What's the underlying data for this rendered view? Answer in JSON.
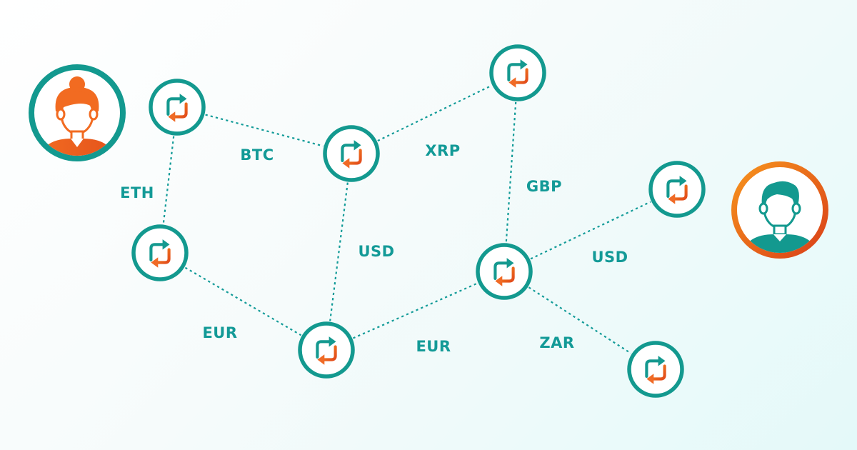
{
  "colors": {
    "teal": "#13998f",
    "label_teal": "#139a97",
    "orange": "#f37021",
    "orange_dark": "#e0471a",
    "skin": "#ffffff"
  },
  "icons": {
    "node": "exchange-arrows-icon",
    "sender": "woman-avatar-icon",
    "receiver": "man-avatar-icon"
  },
  "nodes": [
    {
      "id": "n1"
    },
    {
      "id": "n2"
    },
    {
      "id": "n3"
    },
    {
      "id": "n4"
    },
    {
      "id": "n5"
    },
    {
      "id": "n6"
    },
    {
      "id": "n7"
    },
    {
      "id": "n8"
    },
    {
      "id": "n9"
    }
  ],
  "edges": [
    {
      "from": "n1",
      "to": "n2",
      "label": "BTC"
    },
    {
      "from": "n1",
      "to": "n4",
      "label": "ETH"
    },
    {
      "from": "n2",
      "to": "n3",
      "label": "XRP"
    },
    {
      "from": "n2",
      "to": "n5",
      "label": "USD"
    },
    {
      "from": "n3",
      "to": "n6",
      "label": "GBP"
    },
    {
      "from": "n4",
      "to": "n5",
      "label": "EUR"
    },
    {
      "from": "n5",
      "to": "n6",
      "label": "EUR"
    },
    {
      "from": "n6",
      "to": "n7",
      "label": "USD"
    },
    {
      "from": "n6",
      "to": "n8",
      "label": "ZAR"
    }
  ]
}
